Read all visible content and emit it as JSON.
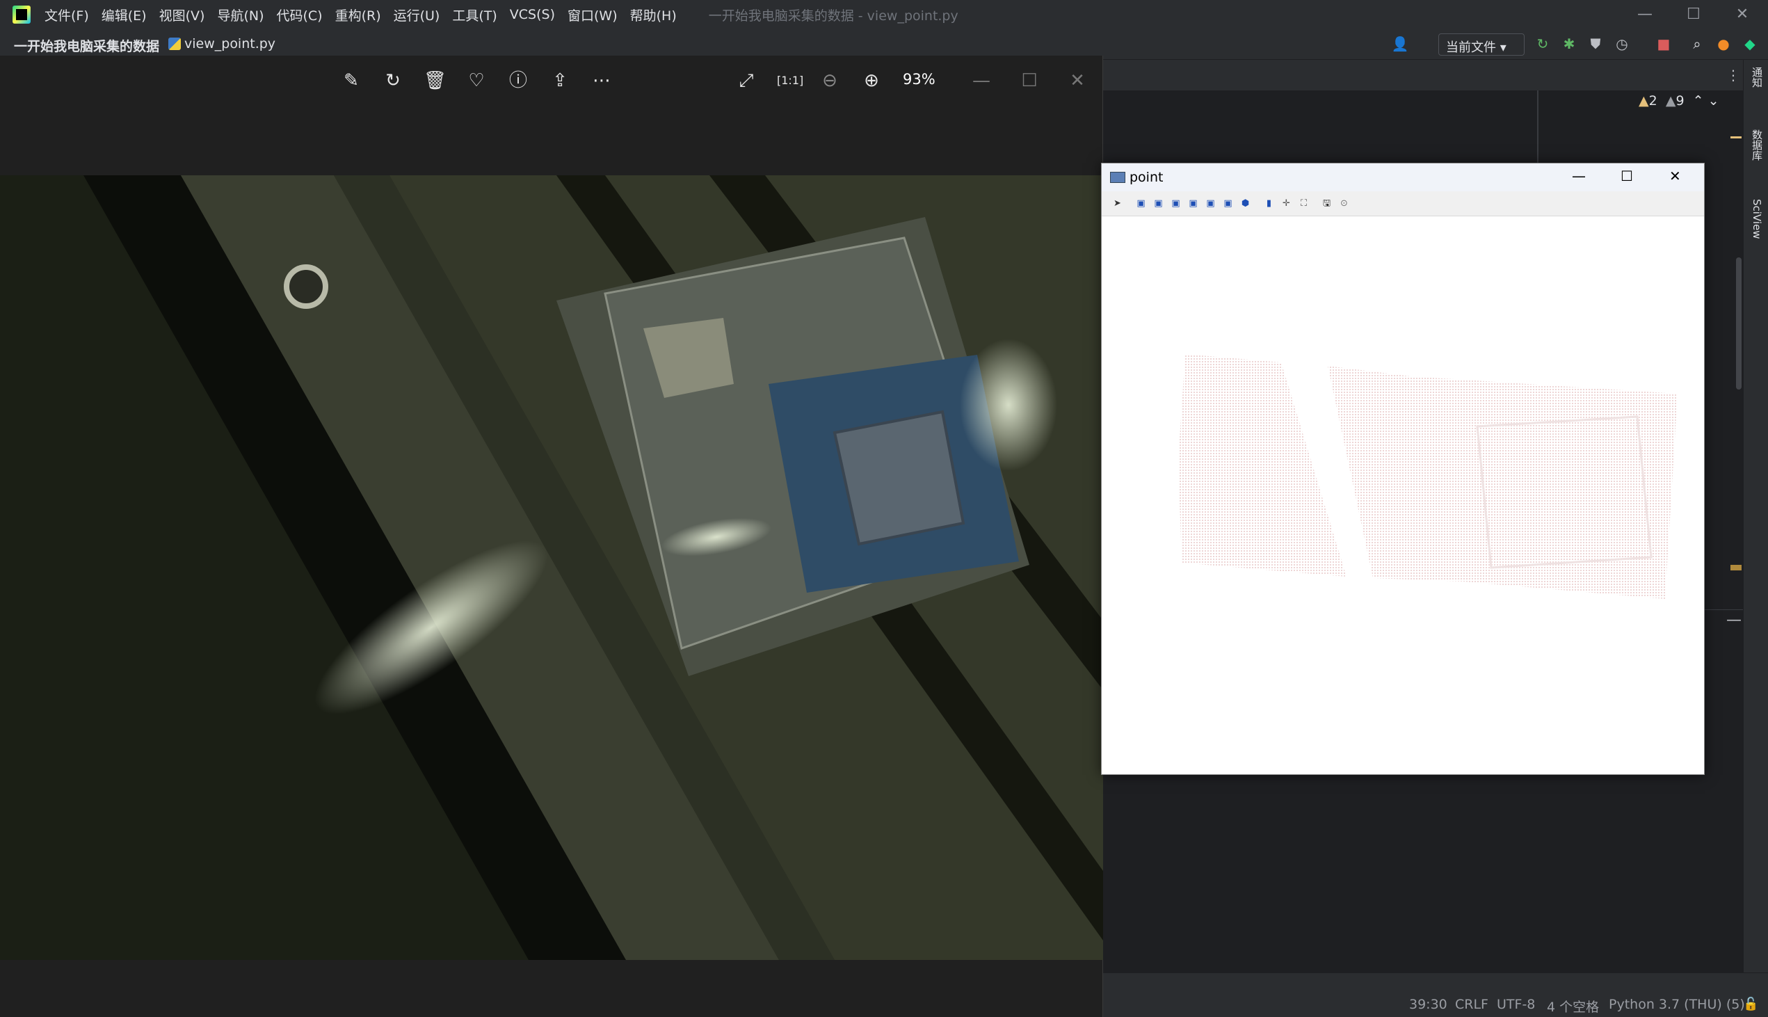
{
  "menubar": {
    "items": [
      "文件(F)",
      "编辑(E)",
      "视图(V)",
      "导航(N)",
      "代码(C)",
      "重构(R)",
      "运行(U)",
      "工具(T)",
      "VCS(S)",
      "窗口(W)",
      "帮助(H)"
    ],
    "title": "一开始我电脑采集的数据 - view_point.py"
  },
  "nav": {
    "project": "一开始我电脑采集的数据",
    "file": "view_point.py",
    "run_config": "当前文件"
  },
  "editor": {
    "warnings_count": "2",
    "weak_warnings_count": "9"
  },
  "side_tabs": [
    "通知",
    "数据库",
    "SciView"
  ],
  "viewer": {
    "zoom": "93%"
  },
  "point_window": {
    "title": "point"
  },
  "status": {
    "position": "39:30",
    "line_sep": "CRLF",
    "encoding": "UTF-8",
    "indent": "4 个空格",
    "interpreter": "Python 3.7 (THU) (5)"
  },
  "colors": {
    "accent": "#3574f0",
    "run": "#5fb865",
    "stop": "#db5c5c",
    "warn": "#e5c07b"
  }
}
